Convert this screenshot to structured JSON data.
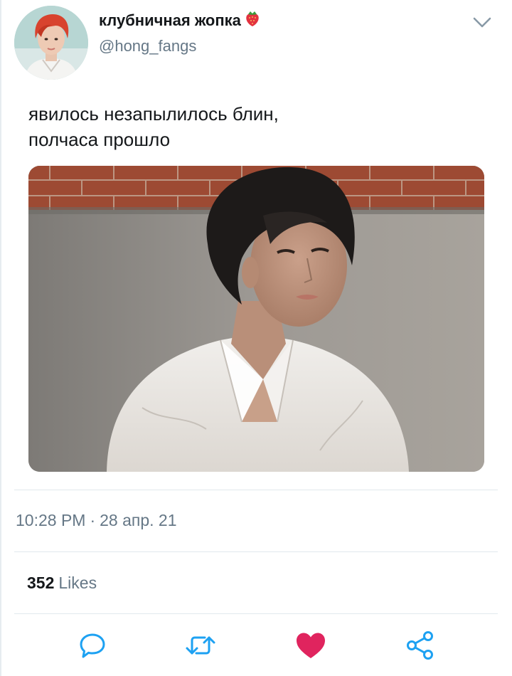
{
  "author": {
    "display_name": "клубничная жопка",
    "handle": "@hong_fangs",
    "name_emoji_icon": "strawberry-icon",
    "avatar_icon": "profile-avatar"
  },
  "tweet": {
    "text_lines": [
      "явилось незапылилось блин,",
      "полчаса прошло"
    ],
    "time": "10:28 PM",
    "separator": "·",
    "date": "28 апр. 21"
  },
  "stats": {
    "likes_count": "352",
    "likes_label": "Likes"
  },
  "actions": [
    {
      "name": "reply",
      "icon": "speech-bubble-icon"
    },
    {
      "name": "retweet",
      "icon": "retweet-arrows-icon"
    },
    {
      "name": "like",
      "icon": "heart-icon",
      "active": true
    },
    {
      "name": "share",
      "icon": "share-nodes-icon"
    }
  ],
  "colors": {
    "primary_text": "#14171a",
    "secondary_text": "#657786",
    "divider": "#e1e8ed",
    "icon": "#1da1f2",
    "like_active": "#e0245e"
  }
}
